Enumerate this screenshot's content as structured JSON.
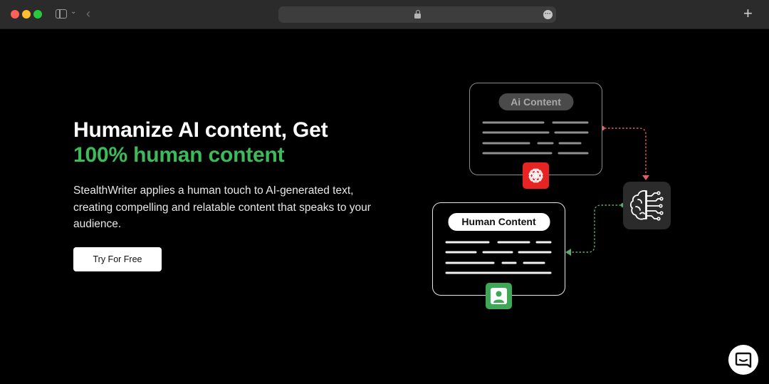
{
  "browser": {
    "tab_icons": [
      "sidebar-icon",
      "chevron-down-icon",
      "back-arrow-icon",
      "lock-icon",
      "more-icon",
      "plus-icon"
    ],
    "traffic_colors": [
      "#fe5f57",
      "#febc2e",
      "#28c840"
    ]
  },
  "hero": {
    "title_line1": "Humanize AI content, Get",
    "title_line2": "100% human content",
    "description": "StealthWriter applies a human touch to AI-generated text, creating compelling and relatable content that speaks to your audience.",
    "cta_label": "Try For Free",
    "accent_color": "#3dbb5c"
  },
  "illustration": {
    "ai_card_label": "Ai Content",
    "human_card_label": "Human Content",
    "ai_badge_color": "#e62424",
    "human_badge_color": "#3fa857",
    "ai_arrow_color": "#e06060",
    "human_arrow_color": "#5cab6a"
  },
  "chat": {
    "icon": "chat-icon"
  }
}
